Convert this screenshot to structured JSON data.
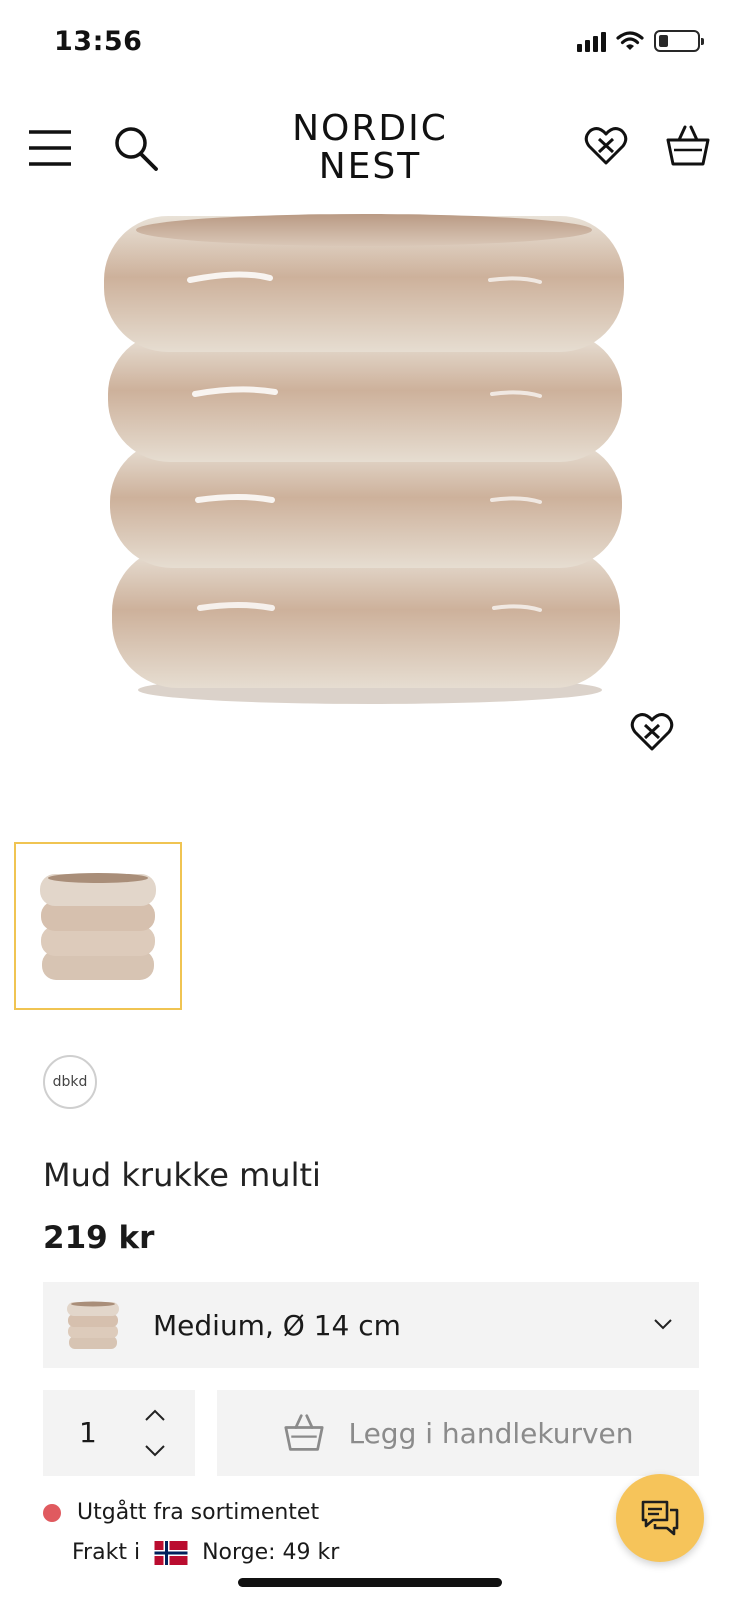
{
  "status_bar": {
    "time": "13:56",
    "battery_level": 0.25,
    "icons": [
      "signal-icon",
      "wifi-icon",
      "battery-icon"
    ]
  },
  "header": {
    "logo_line1": "NORDIC",
    "logo_line2": "NEST",
    "icons": [
      "hamburger-menu-icon",
      "search-icon",
      "wishlist-heart-icon",
      "shopping-basket-icon"
    ]
  },
  "product": {
    "brand": "dbkd",
    "title": "Mud krukke multi",
    "price": "219 kr"
  },
  "variant": {
    "selected": "Medium, Ø 14 cm"
  },
  "quantity": {
    "value": "1"
  },
  "add_to_cart": {
    "label": "Legg i handlekurven"
  },
  "stock": {
    "status": "Utgått fra sortimentet",
    "status_color": "#e05a5f"
  },
  "shipping": {
    "prefix": "Frakt i",
    "country_price": "Norge: 49 kr"
  },
  "colors": {
    "accent": "#f6c45a",
    "thumb_border": "#f0c452",
    "panel_bg": "#f3f3f3"
  }
}
